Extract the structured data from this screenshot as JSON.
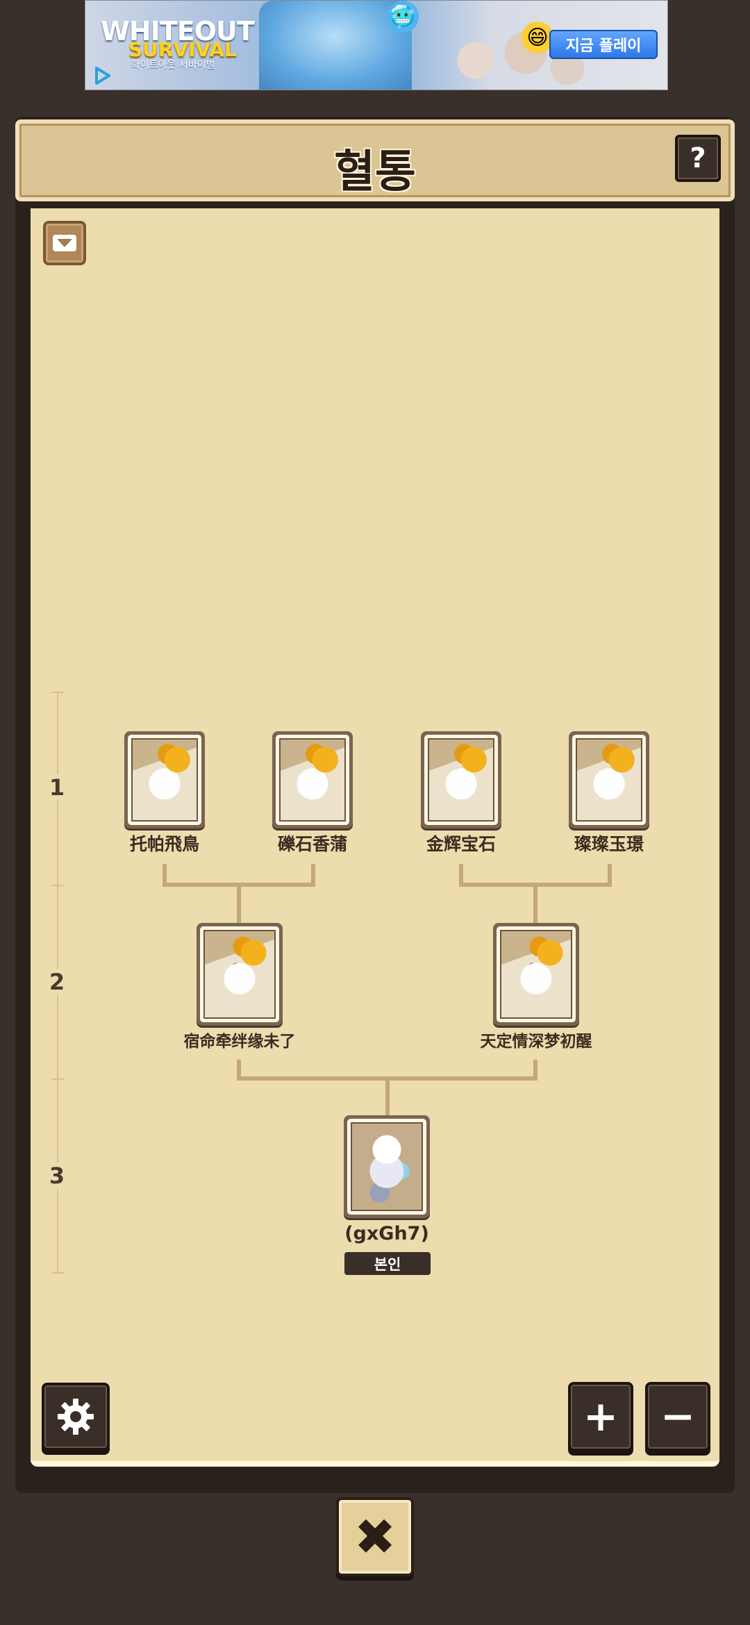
{
  "ad": {
    "brand_line1": "WHITEOUT",
    "brand_line2": "SURVIVAL",
    "brand_sub": "화이트아웃 서바이벌",
    "cta_label": "지금 플레이"
  },
  "header": {
    "title": "혈통",
    "help_label": "?"
  },
  "generations": [
    "1",
    "2",
    "3"
  ],
  "tree": {
    "gen1": [
      {
        "name": "托帕飛鳥"
      },
      {
        "name": "礫石香蒲"
      },
      {
        "name": "金辉宝石"
      },
      {
        "name": "璨璨玉璟"
      }
    ],
    "gen2": [
      {
        "name": "宿命牵绊缘未了"
      },
      {
        "name": "天定情深梦初醒"
      }
    ],
    "self": {
      "name": "(gxGh7)",
      "tag": "본인"
    }
  },
  "controls": {
    "zoom_in_label": "+",
    "zoom_out_label": "−",
    "close_label": "✖"
  },
  "colors": {
    "background": "#3a302b",
    "panel": "#ecdcae",
    "header": "#dcc594",
    "button_dark": "#3a2e28",
    "connector": "#c4a77a"
  }
}
